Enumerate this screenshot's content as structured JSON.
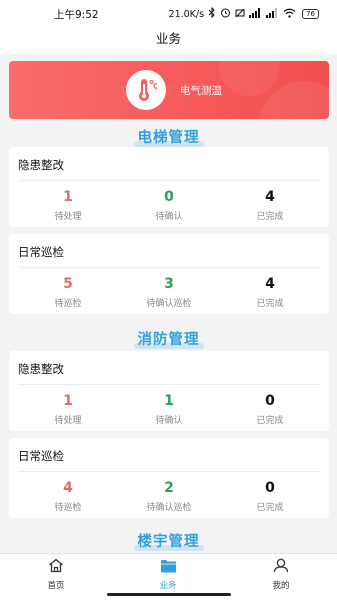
{
  "status_bar": {
    "time": "上午9:52",
    "net_speed": "21.0K/s",
    "battery": "76"
  },
  "header": {
    "title": "业务"
  },
  "banner": {
    "label": "电气测温",
    "icon": "thermometer-icon"
  },
  "sections": [
    {
      "title": "电梯管理",
      "cards": [
        {
          "title": "隐患整改",
          "stats": [
            {
              "value": "1",
              "label": "待处理"
            },
            {
              "value": "0",
              "label": "待确认"
            },
            {
              "value": "4",
              "label": "已完成"
            }
          ]
        },
        {
          "title": "日常巡检",
          "stats": [
            {
              "value": "5",
              "label": "待巡检"
            },
            {
              "value": "3",
              "label": "待确认巡检"
            },
            {
              "value": "4",
              "label": "已完成"
            }
          ]
        }
      ]
    },
    {
      "title": "消防管理",
      "cards": [
        {
          "title": "隐患整改",
          "stats": [
            {
              "value": "1",
              "label": "待处理"
            },
            {
              "value": "1",
              "label": "待确认"
            },
            {
              "value": "0",
              "label": "已完成"
            }
          ]
        },
        {
          "title": "日常巡检",
          "stats": [
            {
              "value": "4",
              "label": "待巡检"
            },
            {
              "value": "2",
              "label": "待确认巡检"
            },
            {
              "value": "0",
              "label": "已完成"
            }
          ]
        }
      ]
    },
    {
      "title": "楼宇管理"
    }
  ],
  "bottom_nav": [
    {
      "label": "首页",
      "icon": "home-icon"
    },
    {
      "label": "业务",
      "icon": "folder-icon",
      "active": true
    },
    {
      "label": "我的",
      "icon": "user-icon"
    }
  ],
  "colors": {
    "accent": "#2fa0dd",
    "banner": "#f65b5b",
    "pending": "#e46b6b",
    "confirm": "#27a15c",
    "done": "#111111"
  }
}
